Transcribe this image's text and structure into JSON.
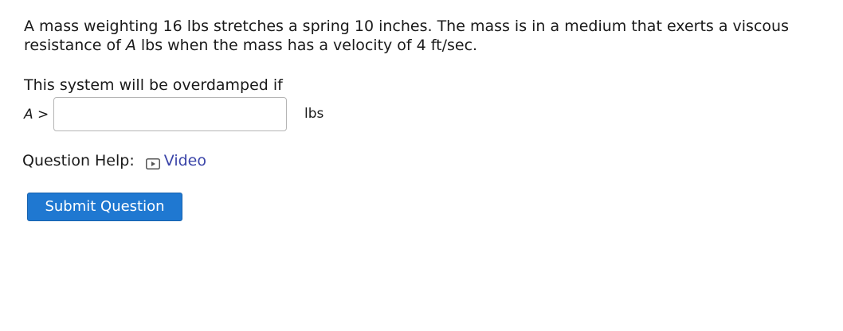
{
  "problem": {
    "part1": "A mass weighting 16 lbs stretches a spring 10 inches. The mass is in a medium that exerts a viscous resistance of ",
    "variable": "A",
    "part2": " lbs when the mass has a velocity of 4 ft/sec."
  },
  "prompt": "This system will be overdamped if",
  "answer": {
    "variable": "A",
    "relation": " >",
    "value": "",
    "placeholder": "",
    "unit": "lbs"
  },
  "help": {
    "label": "Question Help:",
    "icon": "video-play-icon",
    "link_label": "Video",
    "link_color": "#3a44a8"
  },
  "submit": {
    "label": "Submit Question",
    "color": "#1f78d1"
  }
}
